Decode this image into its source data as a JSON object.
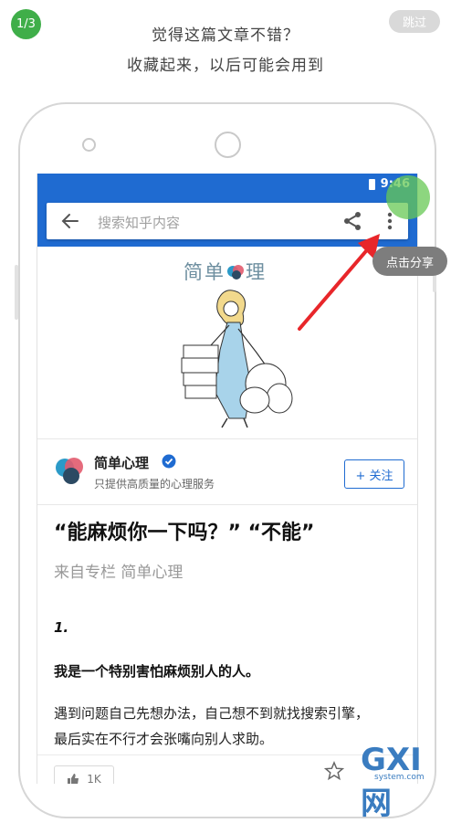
{
  "guide": {
    "step": "1/3",
    "skip_label": "跳过",
    "line1": "觉得这篇文章不错？",
    "line2": "收藏起来，以后可能会用到",
    "tooltip": "点击分享"
  },
  "status": {
    "time": "9:46"
  },
  "search": {
    "placeholder": "搜索知乎内容"
  },
  "column": {
    "brand_left": "简单",
    "brand_right": "理",
    "name": "简单心理",
    "desc": "只提供高质量的心理服务",
    "follow_label": "+ 关注"
  },
  "article": {
    "title": "“能麻烦你一下吗？” “不能”",
    "from": "来自专栏 简单心理",
    "section_num": "1.",
    "bold_para": "我是一个特别害怕麻烦别人的人。",
    "para_line1": "遇到问题自己先想办法，自己想不到就找搜索引擎，",
    "para_line2": "最后实在不行才会张嘴向别人求助。"
  },
  "bottom": {
    "like_count": "1K"
  },
  "watermark": {
    "main": "GXI网",
    "sub": "system.com"
  },
  "colors": {
    "accent": "#1f6bd1",
    "step_badge": "#3fae49",
    "tap_circle": "#67c854",
    "arrow": "#e8262a"
  }
}
